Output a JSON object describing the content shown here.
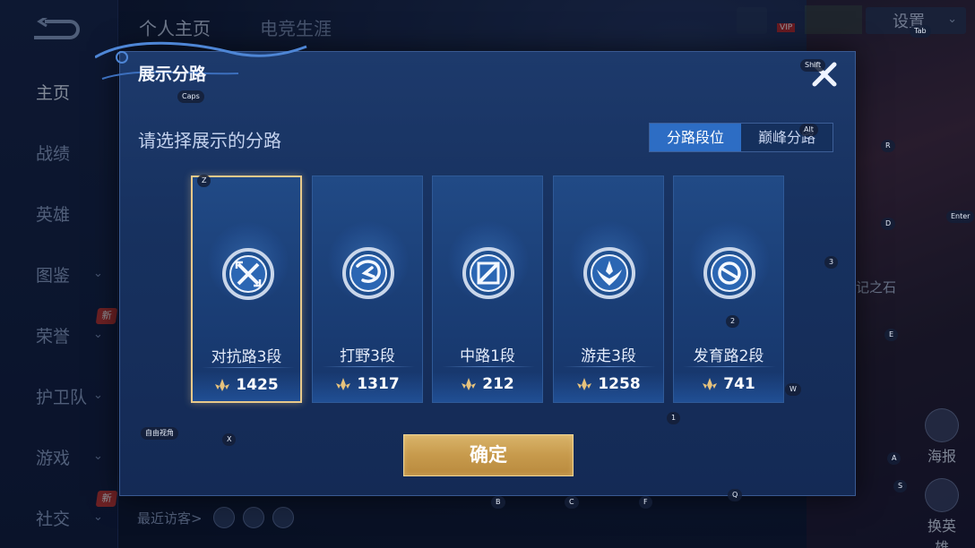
{
  "sidebar": {
    "items": [
      {
        "label": "主页",
        "active": true,
        "chevron": false,
        "badge": ""
      },
      {
        "label": "战绩",
        "active": false,
        "chevron": false,
        "badge": ""
      },
      {
        "label": "英雄",
        "active": false,
        "chevron": false,
        "badge": ""
      },
      {
        "label": "图鉴",
        "active": false,
        "chevron": true,
        "badge": ""
      },
      {
        "label": "荣誉",
        "active": false,
        "chevron": true,
        "badge": "新"
      },
      {
        "label": "护卫队",
        "active": false,
        "chevron": true,
        "badge": ""
      },
      {
        "label": "游戏",
        "active": false,
        "chevron": true,
        "badge": ""
      },
      {
        "label": "社交",
        "active": false,
        "chevron": true,
        "badge": "新"
      }
    ]
  },
  "header": {
    "tabs": [
      "个人主页",
      "电竞生涯"
    ],
    "settings_label": "设置",
    "vip_label": "VIP"
  },
  "recent_visitors_label": "最近访客>",
  "right_panel": {
    "stone_label": "记之石",
    "poster_label": "海报",
    "change_hero_label": "换英雄"
  },
  "key_hints": {
    "caps": "Caps",
    "shift": "Shift",
    "alt": "Alt",
    "tab": "Tab",
    "enter": "Enter",
    "r": "R",
    "d": "D",
    "e": "E",
    "w": "W",
    "a": "A",
    "s": "S",
    "q": "Q",
    "f": "F",
    "c": "C",
    "b": "B",
    "x": "X",
    "z": "Z",
    "n1": "1",
    "n2": "2",
    "n3": "3",
    "hint_bottom_left": "自由视角"
  },
  "modal": {
    "title": "展示分路",
    "subtitle": "请选择展示的分路",
    "segment": [
      {
        "label": "分路段位",
        "active": true
      },
      {
        "label": "巅峰分路",
        "active": false
      }
    ],
    "cards": [
      {
        "role": "对抗路3段",
        "score": "1425",
        "selected": true,
        "icon": "swords-emblem-icon"
      },
      {
        "role": "打野3段",
        "score": "1317",
        "selected": false,
        "icon": "dragon-emblem-icon"
      },
      {
        "role": "中路1段",
        "score": "212",
        "selected": false,
        "icon": "staff-emblem-icon"
      },
      {
        "role": "游走3段",
        "score": "1258",
        "selected": false,
        "icon": "wings-emblem-icon"
      },
      {
        "role": "发育路2段",
        "score": "741",
        "selected": false,
        "icon": "target-emblem-icon"
      }
    ],
    "confirm_label": "确定"
  },
  "colors": {
    "accent_blue": "#2d6dc4",
    "gold": "#e8c98a",
    "confirm_gold": "#c79a4c",
    "badge_red": "#c3342f"
  }
}
